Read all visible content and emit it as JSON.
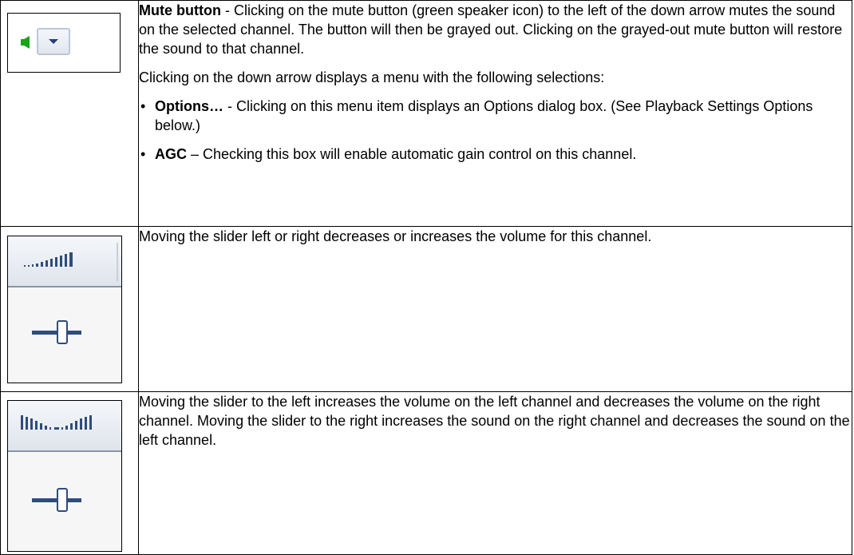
{
  "rows": [
    {
      "icon": "mute-dropdown-icon",
      "title": "Mute button",
      "intro": " - Clicking on the mute button (green speaker icon) to the left of the down arrow mutes the sound on the selected channel. The button will then be grayed out. Clicking on the grayed-out mute button will restore the sound to that channel.",
      "menu_intro": "Clicking on the down arrow displays a menu with the following selections:",
      "menu_items": [
        {
          "bullet": "•",
          "label": "Options…",
          "text": " - Clicking on this menu item displays an Options dialog box. (See Playback Settings Options below.)"
        },
        {
          "bullet": "•",
          "label": "AGC",
          "text": " – Checking this box will enable automatic gain control on this channel."
        }
      ]
    },
    {
      "icon": "volume-slider-icon",
      "text": "Moving the slider left or right decreases or increases the volume for this channel."
    },
    {
      "icon": "balance-slider-icon",
      "text": "Moving the slider to the left increases the volume on the left channel and decreases the volume on the right channel. Moving the slider to the right increases the sound on the right channel and decreases the sound on the left channel."
    }
  ],
  "colors": {
    "speaker_green": "#1aa31a",
    "slider_blue": "#2f4c7c",
    "border": "#000000"
  }
}
